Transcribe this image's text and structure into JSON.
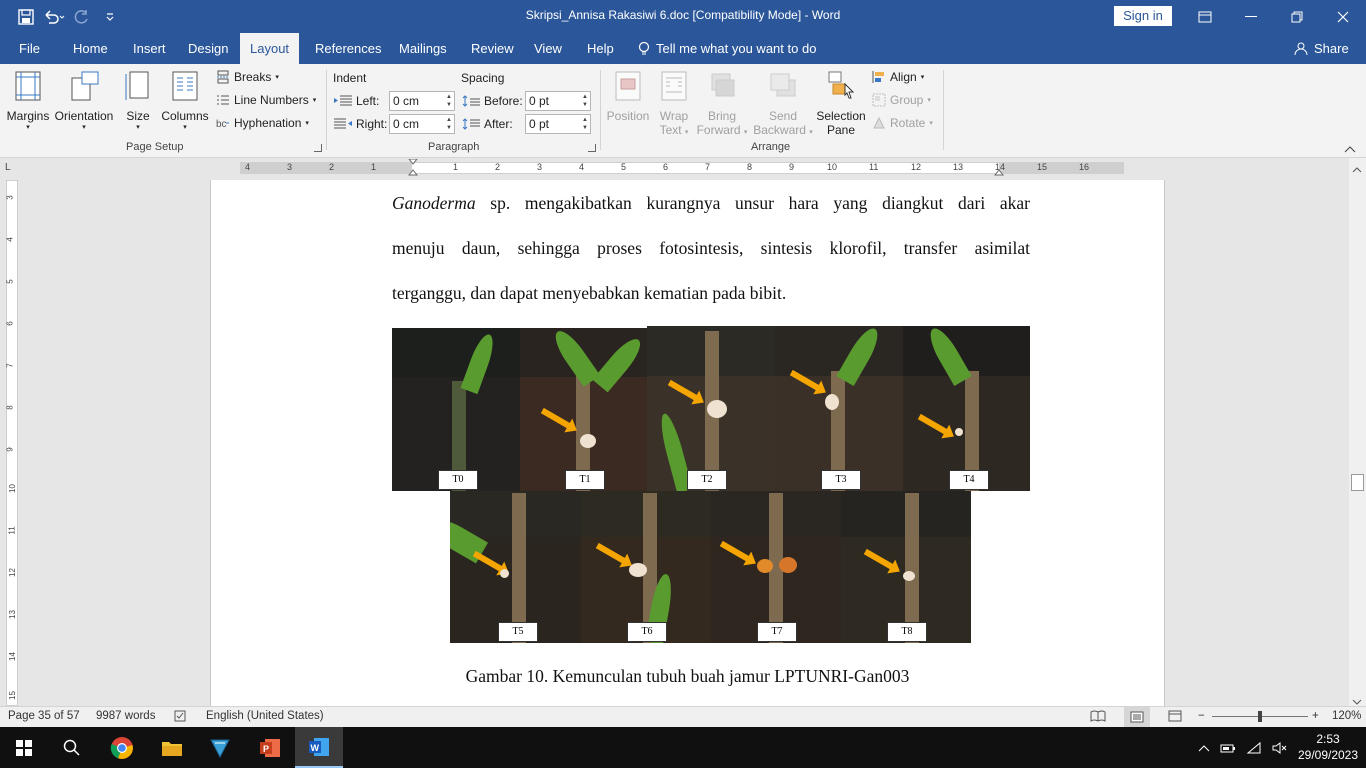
{
  "window": {
    "title": "Skripsi_Annisa Rakasiwi 6.doc [Compatibility Mode]  -  Word",
    "sign_in": "Sign in"
  },
  "tabs": [
    "File",
    "Home",
    "Insert",
    "Design",
    "Layout",
    "References",
    "Mailings",
    "Review",
    "View",
    "Help"
  ],
  "tell_me": "Tell me what you want to do",
  "share": "Share",
  "ribbon": {
    "page_setup": {
      "margins": "Margins",
      "orientation": "Orientation",
      "size": "Size",
      "columns": "Columns",
      "breaks": "Breaks",
      "line_numbers": "Line Numbers",
      "hyphenation": "Hyphenation",
      "label": "Page Setup"
    },
    "paragraph": {
      "indent": "Indent",
      "spacing": "Spacing",
      "left_label": "Left:",
      "left_value": "0 cm",
      "right_label": "Right:",
      "right_value": "0 cm",
      "before_label": "Before:",
      "before_value": "0 pt",
      "after_label": "After:",
      "after_value": "0 pt",
      "label": "Paragraph"
    },
    "arrange": {
      "position": "Position",
      "wrap_text_1": "Wrap",
      "wrap_text_2": "Text",
      "bring_forward_1": "Bring",
      "bring_forward_2": "Forward",
      "send_backward_1": "Send",
      "send_backward_2": "Backward",
      "selection_pane_1": "Selection",
      "selection_pane_2": "Pane",
      "align": "Align",
      "group": "Group",
      "rotate": "Rotate",
      "label": "Arrange"
    }
  },
  "ruler": {
    "h_numbers": [
      "4",
      "3",
      "2",
      "1",
      "1",
      "2",
      "3",
      "4",
      "5",
      "6",
      "7",
      "8",
      "9",
      "10",
      "11",
      "12",
      "13",
      "14",
      "15",
      "16"
    ],
    "v_numbers": [
      "3",
      "4",
      "5",
      "6",
      "7",
      "8",
      "9",
      "10",
      "11",
      "12",
      "13",
      "14",
      "15"
    ],
    "corner": "L"
  },
  "document": {
    "para_line1_italic": "Ganoderma",
    "para_line1_rest": " sp. mengakibatkan kurangnya unsur hara yang diangkut dari akar",
    "para_line2": "menuju daun, sehingga proses fotosintesis, sintesis klorofil, transfer asimilat",
    "para_line3": "terganggu, dan dapat menyebabkan kematian pada bibit.",
    "photo_labels_top": [
      "T0",
      "T1",
      "T2",
      "T3",
      "T4"
    ],
    "photo_labels_bottom": [
      "T5",
      "T6",
      "T7",
      "T8"
    ],
    "caption": "Gambar 10. Kemunculan tubuh buah jamur LPTUNRI-Gan003"
  },
  "status": {
    "page": "Page 35 of 57",
    "words": "9987 words",
    "language": "English (United States)",
    "zoom": "120%"
  },
  "taskbar": {
    "time": "2:53",
    "date": "29/09/2023"
  },
  "colors": {
    "word_blue": "#2b579a",
    "arrow_orange": "#f5a500"
  }
}
